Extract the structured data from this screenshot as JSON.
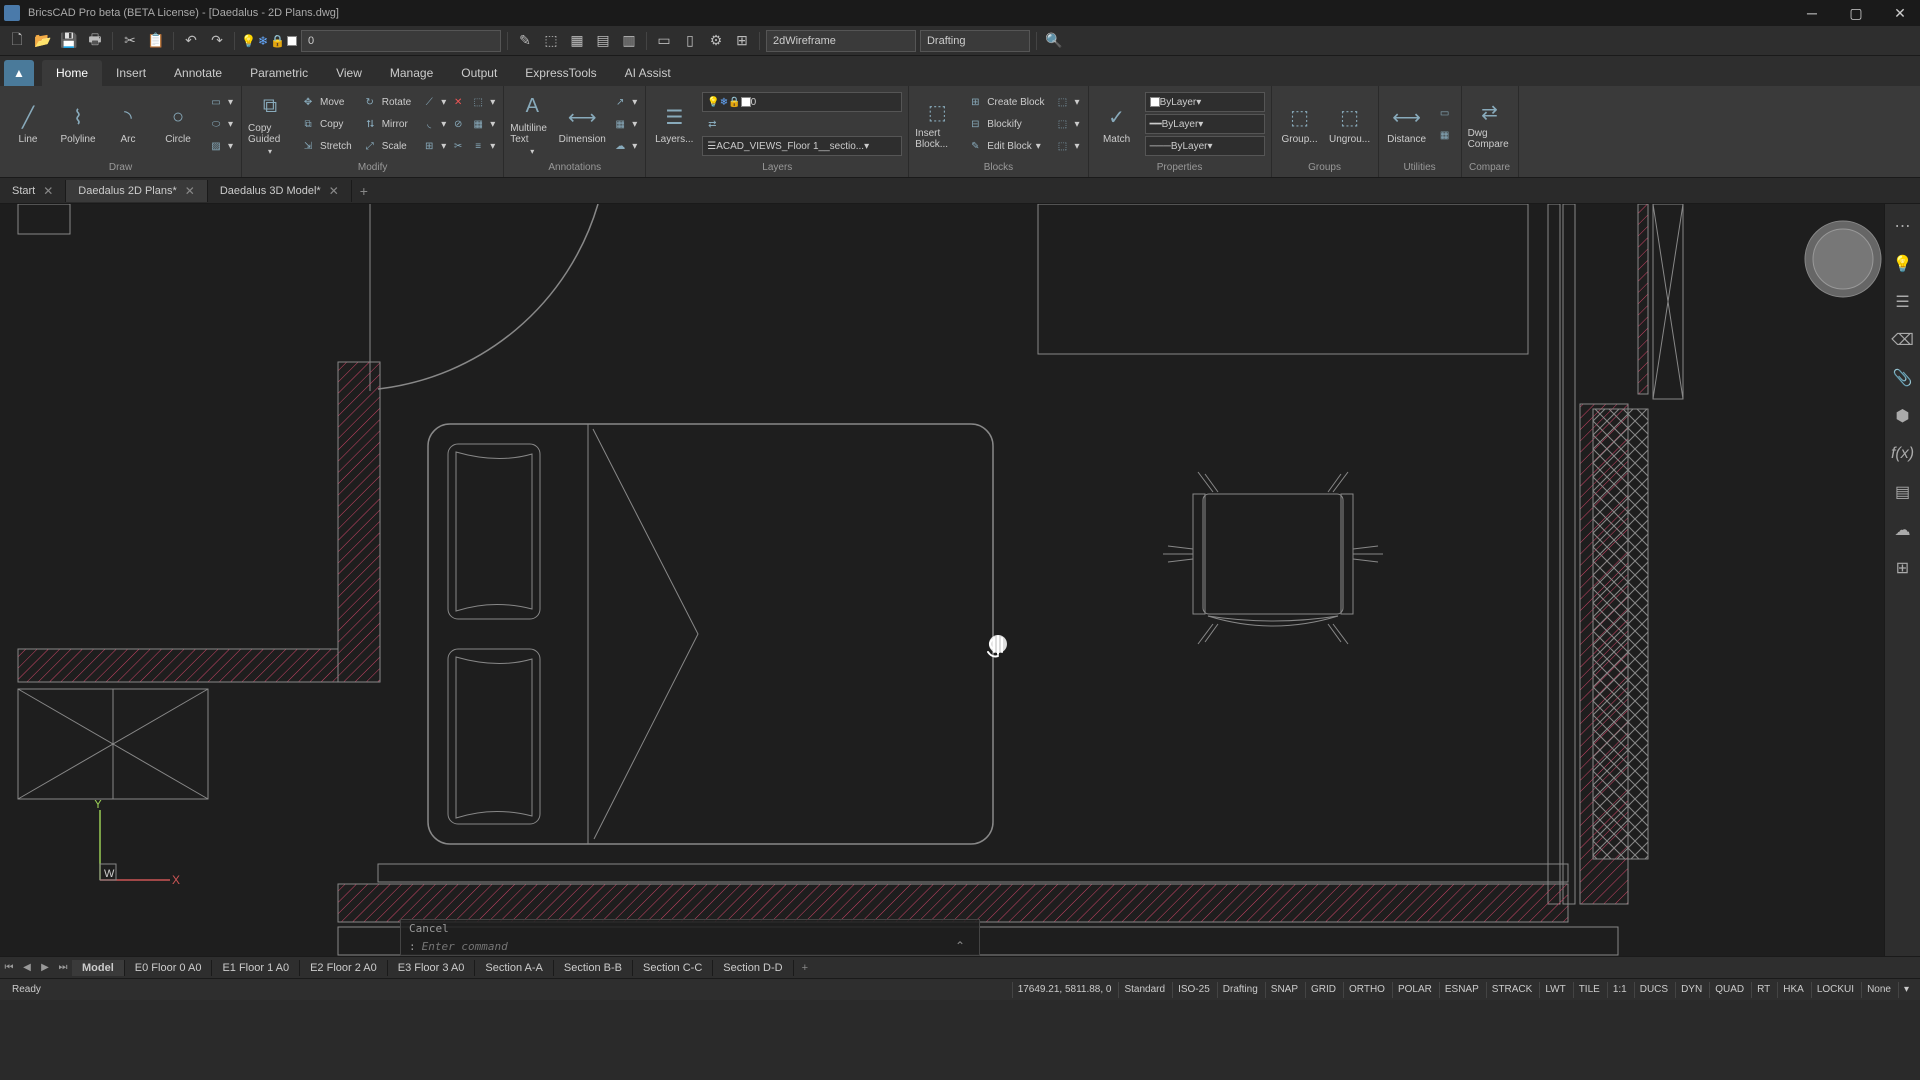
{
  "window": {
    "title": "BricsCAD Pro beta (BETA License) - [Daedalus - 2D Plans.dwg]"
  },
  "qat": {
    "layer_value": "0",
    "visual_style": "2dWireframe",
    "workspace": "Drafting"
  },
  "ribbon_tabs": [
    "Home",
    "Insert",
    "Annotate",
    "Parametric",
    "View",
    "Manage",
    "Output",
    "ExpressTools",
    "AI Assist"
  ],
  "ribbon": {
    "draw": {
      "line": "Line",
      "polyline": "Polyline",
      "arc": "Arc",
      "circle": "Circle",
      "label": "Draw"
    },
    "modify": {
      "copy_guided": "Copy Guided",
      "move": "Move",
      "copy": "Copy",
      "stretch": "Stretch",
      "rotate": "Rotate",
      "mirror": "Mirror",
      "scale": "Scale",
      "label": "Modify"
    },
    "annotations": {
      "mtext": "Multiline Text",
      "dimension": "Dimension",
      "label": "Annotations"
    },
    "layers": {
      "btn": "Layers...",
      "row_value": "0",
      "current": "ACAD_VIEWS_Floor 1__sectio...",
      "label": "Layers"
    },
    "blocks": {
      "insert": "Insert Block...",
      "create": "Create Block",
      "blockify": "Blockify",
      "edit": "Edit Block",
      "label": "Blocks"
    },
    "properties": {
      "match": "Match",
      "bylayer1": "ByLayer",
      "bylayer2": "ByLayer",
      "bylayer3": "ByLayer",
      "label": "Properties"
    },
    "groups": {
      "group": "Group...",
      "ungroup": "Ungrou...",
      "label": "Groups"
    },
    "utilities": {
      "distance": "Distance",
      "label": "Utilities"
    },
    "compare": {
      "dwg": "Dwg Compare",
      "label": "Compare"
    }
  },
  "doctabs": {
    "start": "Start",
    "tab1": "Daedalus 2D Plans*",
    "tab2": "Daedalus 3D Model*"
  },
  "ucs": {
    "x": "X",
    "y": "Y",
    "w": "W"
  },
  "cmdline": {
    "history": "Cancel",
    "prompt": ":",
    "placeholder": "Enter command"
  },
  "layout_tabs": [
    "Model",
    "E0 Floor 0 A0",
    "E1 Floor 1 A0",
    "E2 Floor 2 A0",
    "E3 Floor 3 A0",
    "Section A-A",
    "Section B-B",
    "Section C-C",
    "Section D-D"
  ],
  "status": {
    "ready": "Ready",
    "coords": "17649.21, 5811.88, 0",
    "std": "Standard",
    "iso": "ISO-25",
    "ws": "Drafting",
    "toggles": [
      "SNAP",
      "GRID",
      "ORTHO",
      "POLAR",
      "ESNAP",
      "STRACK",
      "LWT",
      "TILE",
      "1:1",
      "DUCS",
      "DYN",
      "QUAD",
      "RT",
      "HKA",
      "LOCKUI"
    ],
    "annot": "None"
  }
}
